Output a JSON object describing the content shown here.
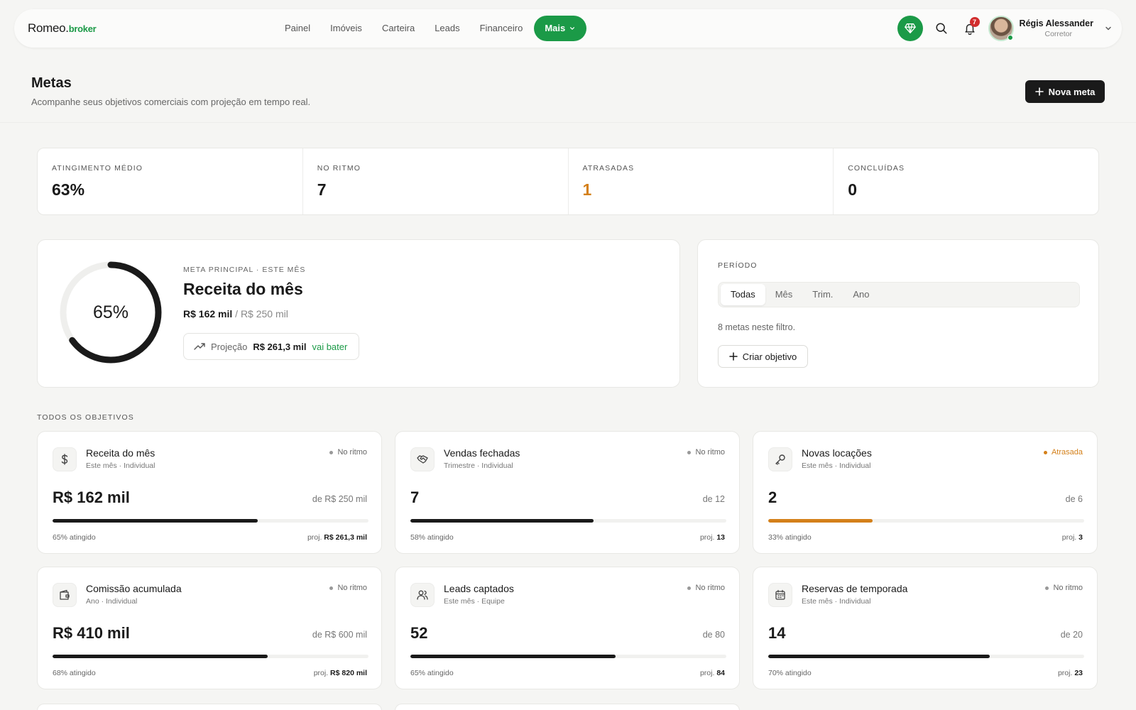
{
  "brand": {
    "name": "Romeo.",
    "accent": "broker",
    "accent_color": "#1b9a47"
  },
  "nav": {
    "items": [
      "Painel",
      "Imóveis",
      "Carteira",
      "Leads",
      "Financeiro"
    ],
    "more_label": "Mais"
  },
  "tools": {
    "notifications_count": "7"
  },
  "user": {
    "name": "Régis Alessander",
    "role": "Corretor"
  },
  "header": {
    "title": "Metas",
    "subtitle": "Acompanhe seus objetivos comerciais com projeção em tempo real.",
    "new_goal_label": "Nova meta"
  },
  "stats": [
    {
      "label": "ATINGIMENTO MÉDIO",
      "value": "63%"
    },
    {
      "label": "NO RITMO",
      "value": "7"
    },
    {
      "label": "ATRASADAS",
      "value": "1"
    },
    {
      "label": "CONCLUÍDAS",
      "value": "0"
    }
  ],
  "main_goal": {
    "eyebrow": "META PRINCIPAL · ESTE MÊS",
    "title": "Receita do mês",
    "percent_label": "65%",
    "progress": 0.65,
    "current": "R$ 162 mil",
    "separator": "/",
    "target": "R$ 250 mil",
    "projection_label": "Projeção",
    "projection_value": "R$ 261,3 mil",
    "projection_status": "vai bater"
  },
  "period": {
    "label": "PERÍODO",
    "options": [
      "Todas",
      "Mês",
      "Trim.",
      "Ano"
    ],
    "selected": "Todas",
    "count_text": "8 metas neste filtro.",
    "create_label": "Criar objetivo"
  },
  "section_label": "TODOS OS OBJETIVOS",
  "goals": [
    {
      "name": "Receita do mês",
      "meta": "Este mês · Individual",
      "status": "No ritmo",
      "late": false,
      "value": "R$ 162 mil",
      "target": "de R$ 250 mil",
      "progress": 0.65,
      "pct": "65% atingido",
      "proj_label": "proj.",
      "proj": "R$ 261,3 mil",
      "icon": "dollar-icon"
    },
    {
      "name": "Vendas fechadas",
      "meta": "Trimestre · Individual",
      "status": "No ritmo",
      "late": false,
      "value": "7",
      "target": "de 12",
      "progress": 0.58,
      "pct": "58% atingido",
      "proj_label": "proj.",
      "proj": "13",
      "icon": "handshake-icon"
    },
    {
      "name": "Novas locações",
      "meta": "Este mês · Individual",
      "status": "Atrasada",
      "late": true,
      "value": "2",
      "target": "de 6",
      "progress": 0.33,
      "pct": "33% atingido",
      "proj_label": "proj.",
      "proj": "3",
      "icon": "key-icon"
    },
    {
      "name": "Comissão acumulada",
      "meta": "Ano · Individual",
      "status": "No ritmo",
      "late": false,
      "value": "R$ 410 mil",
      "target": "de R$ 600 mil",
      "progress": 0.68,
      "pct": "68% atingido",
      "proj_label": "proj.",
      "proj": "R$ 820 mil",
      "icon": "wallet-icon"
    },
    {
      "name": "Leads captados",
      "meta": "Este mês · Equipe",
      "status": "No ritmo",
      "late": false,
      "value": "52",
      "target": "de 80",
      "progress": 0.65,
      "pct": "65% atingido",
      "proj_label": "proj.",
      "proj": "84",
      "icon": "users-icon"
    },
    {
      "name": "Reservas de temporada",
      "meta": "Este mês · Individual",
      "status": "No ritmo",
      "late": false,
      "value": "14",
      "target": "de 20",
      "progress": 0.7,
      "pct": "70% atingido",
      "proj_label": "proj.",
      "proj": "23",
      "icon": "calendar-icon"
    }
  ],
  "colors": {
    "accent": "#1b9a47",
    "late": "#d4801a",
    "dark": "#1a1a1a"
  }
}
